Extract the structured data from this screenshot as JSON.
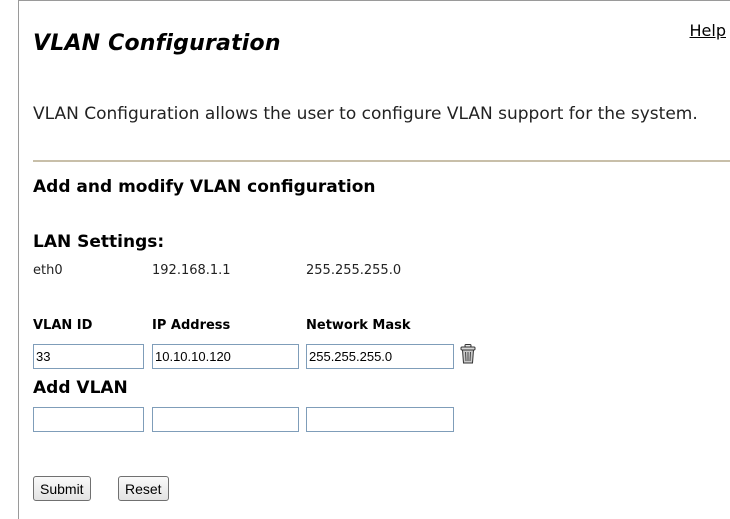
{
  "header": {
    "help_link": "Help",
    "title": "VLAN Configuration",
    "description": "VLAN Configuration allows the user to configure VLAN support for the system."
  },
  "section": {
    "subtitle": "Add and modify VLAN configuration"
  },
  "lan_settings": {
    "heading": "LAN Settings:",
    "interface": "eth0",
    "ip": "192.168.1.1",
    "mask": "255.255.255.0"
  },
  "vlan_table": {
    "columns": [
      "VLAN ID",
      "IP Address",
      "Network Mask"
    ],
    "rows": [
      {
        "vlan_id": "33",
        "ip": "10.10.10.120",
        "mask": "255.255.255.0",
        "delete_icon": "trash-icon"
      }
    ]
  },
  "add_vlan": {
    "heading": "Add VLAN",
    "vlan_id": "",
    "ip": "",
    "mask": ""
  },
  "buttons": {
    "submit": "Submit",
    "reset": "Reset"
  },
  "colors": {
    "divider": "#c8bfa9",
    "input_border": "#7f9db9"
  }
}
